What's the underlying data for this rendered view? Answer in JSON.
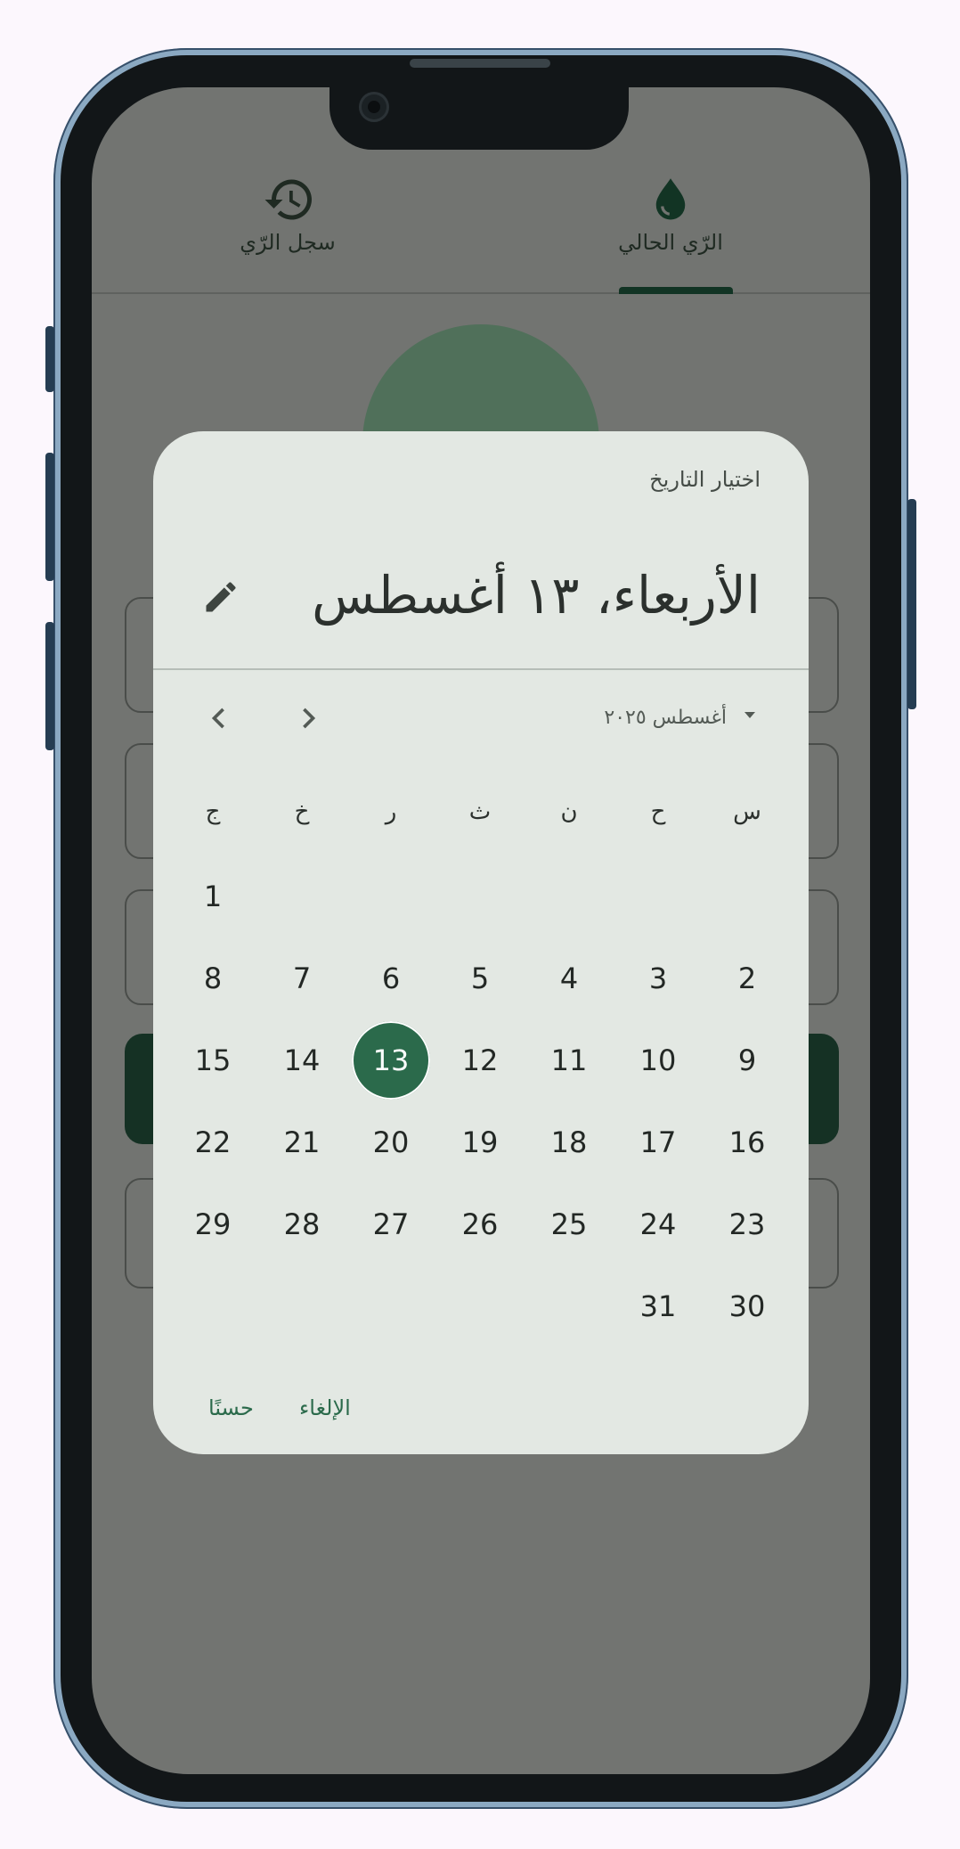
{
  "tabs": [
    {
      "label": "الرّي الحالي",
      "icon": "water-drop-icon",
      "active": true
    },
    {
      "label": "سجل الرّي",
      "icon": "history-icon",
      "active": false
    }
  ],
  "dialog": {
    "title": "اختيار التاريخ",
    "header_date": "الأربعاء، ١٣ أغسطس",
    "month_year": "أغسطس ٢٠٢٥",
    "weekdays": [
      "س",
      "ح",
      "ن",
      "ث",
      "ر",
      "خ",
      "ج"
    ],
    "weeks": [
      [
        "",
        "",
        "",
        "",
        "",
        "",
        "1"
      ],
      [
        "2",
        "3",
        "4",
        "5",
        "6",
        "7",
        "8"
      ],
      [
        "9",
        "10",
        "11",
        "12",
        "13",
        "14",
        "15"
      ],
      [
        "16",
        "17",
        "18",
        "19",
        "20",
        "21",
        "22"
      ],
      [
        "23",
        "24",
        "25",
        "26",
        "27",
        "28",
        "29"
      ],
      [
        "30",
        "31",
        "",
        "",
        "",
        "",
        ""
      ]
    ],
    "selected_day": "13",
    "cancel_label": "الإلغاء",
    "ok_label": "حسنًا"
  },
  "colors": {
    "accent": "#2b6a4b",
    "dialog_bg": "#e3e8e3",
    "scrim": "#727471"
  }
}
